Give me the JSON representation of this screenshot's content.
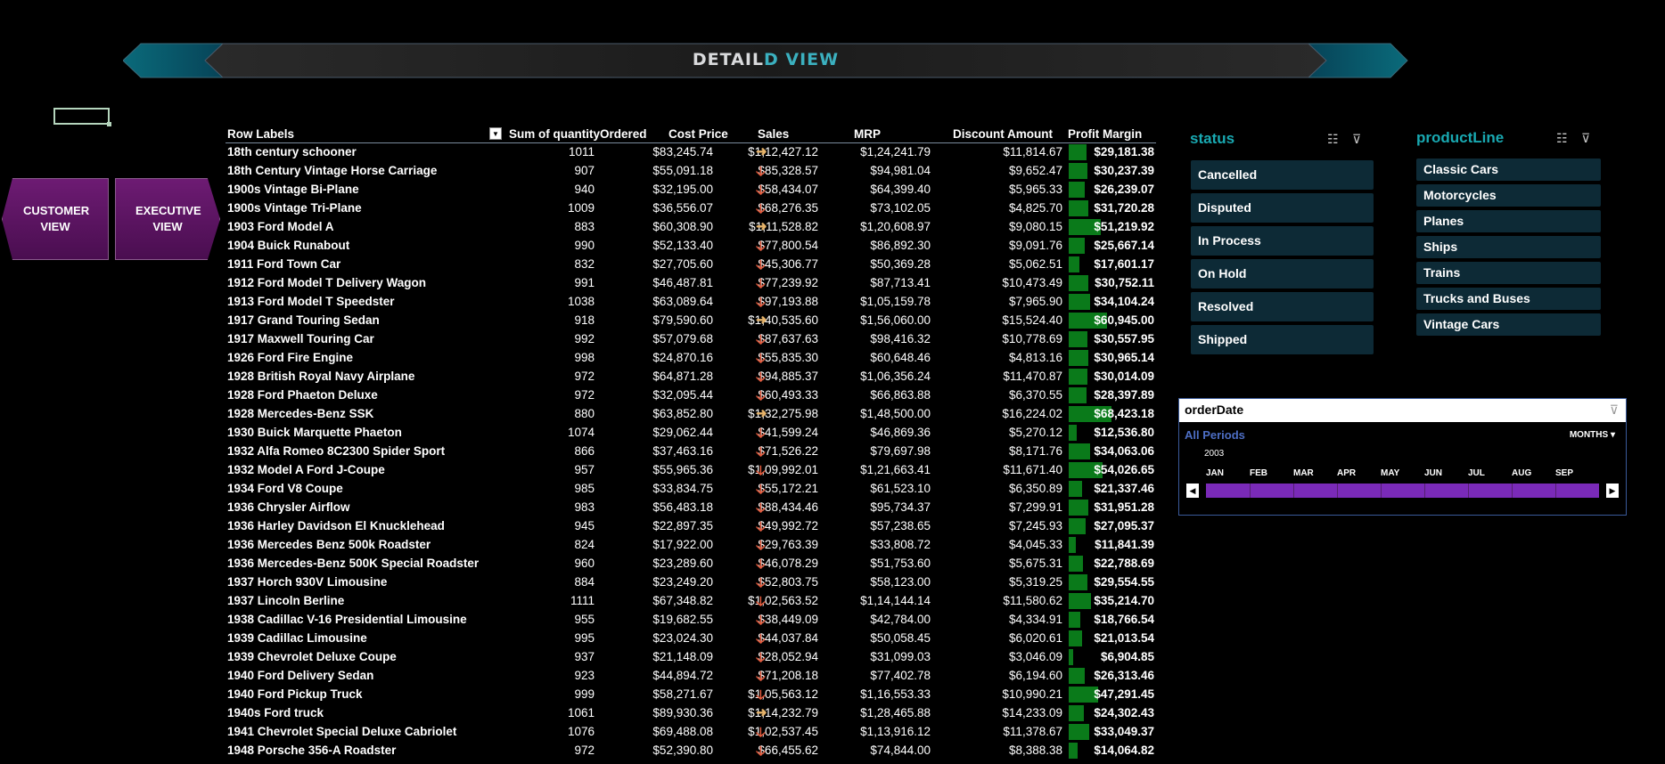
{
  "banner": {
    "title_a": "DETAIL",
    "title_b": "D VIEW"
  },
  "nav": {
    "customer": "CUSTOMER VIEW",
    "executive": "EXECUTIVE VIEW"
  },
  "pivot": {
    "headers": {
      "row_labels": "Row Labels",
      "qty": "Sum of quantityOrdered",
      "cost": "Cost Price",
      "sales": "Sales",
      "mrp": "MRP",
      "discount": "Discount Amount",
      "profit": "Profit Margin"
    },
    "rows": [
      {
        "name": "18th century schooner",
        "qty": "1011",
        "cost": "$83,245.74",
        "icon": "right",
        "sales": "$1,12,427.12",
        "mrp": "$1,24,241.79",
        "disc": "$11,814.67",
        "profit": "$29,181.38",
        "pm": 29181.38
      },
      {
        "name": "18th Century Vintage Horse Carriage",
        "qty": "907",
        "cost": "$55,091.18",
        "icon": "down",
        "sales": "$85,328.57",
        "mrp": "$94,981.04",
        "disc": "$9,652.47",
        "profit": "$30,237.39",
        "pm": 30237.39
      },
      {
        "name": "1900s Vintage Bi-Plane",
        "qty": "940",
        "cost": "$32,195.00",
        "icon": "down",
        "sales": "$58,434.07",
        "mrp": "$64,399.40",
        "disc": "$5,965.33",
        "profit": "$26,239.07",
        "pm": 26239.07
      },
      {
        "name": "1900s Vintage Tri-Plane",
        "qty": "1009",
        "cost": "$36,556.07",
        "icon": "down",
        "sales": "$68,276.35",
        "mrp": "$73,102.05",
        "disc": "$4,825.70",
        "profit": "$31,720.28",
        "pm": 31720.28
      },
      {
        "name": "1903 Ford Model A",
        "qty": "883",
        "cost": "$60,308.90",
        "icon": "right",
        "sales": "$1,11,528.82",
        "mrp": "$1,20,608.97",
        "disc": "$9,080.15",
        "profit": "$51,219.92",
        "pm": 51219.92
      },
      {
        "name": "1904 Buick Runabout",
        "qty": "990",
        "cost": "$52,133.40",
        "icon": "down",
        "sales": "$77,800.54",
        "mrp": "$86,892.30",
        "disc": "$9,091.76",
        "profit": "$25,667.14",
        "pm": 25667.14
      },
      {
        "name": "1911 Ford Town Car",
        "qty": "832",
        "cost": "$27,705.60",
        "icon": "down",
        "sales": "$45,306.77",
        "mrp": "$50,369.28",
        "disc": "$5,062.51",
        "profit": "$17,601.17",
        "pm": 17601.17
      },
      {
        "name": "1912 Ford Model T Delivery Wagon",
        "qty": "991",
        "cost": "$46,487.81",
        "icon": "down",
        "sales": "$77,239.92",
        "mrp": "$87,713.41",
        "disc": "$10,473.49",
        "profit": "$30,752.11",
        "pm": 30752.11
      },
      {
        "name": "1913 Ford Model T Speedster",
        "qty": "1038",
        "cost": "$63,089.64",
        "icon": "down",
        "sales": "$97,193.88",
        "mrp": "$1,05,159.78",
        "disc": "$7,965.90",
        "profit": "$34,104.24",
        "pm": 34104.24
      },
      {
        "name": "1917 Grand Touring Sedan",
        "qty": "918",
        "cost": "$79,590.60",
        "icon": "right",
        "sales": "$1,40,535.60",
        "mrp": "$1,56,060.00",
        "disc": "$15,524.40",
        "profit": "$60,945.00",
        "pm": 60945.0
      },
      {
        "name": "1917 Maxwell Touring Car",
        "qty": "992",
        "cost": "$57,079.68",
        "icon": "down",
        "sales": "$87,637.63",
        "mrp": "$98,416.32",
        "disc": "$10,778.69",
        "profit": "$30,557.95",
        "pm": 30557.95
      },
      {
        "name": "1926 Ford Fire Engine",
        "qty": "998",
        "cost": "$24,870.16",
        "icon": "down",
        "sales": "$55,835.30",
        "mrp": "$60,648.46",
        "disc": "$4,813.16",
        "profit": "$30,965.14",
        "pm": 30965.14
      },
      {
        "name": "1928 British Royal Navy Airplane",
        "qty": "972",
        "cost": "$64,871.28",
        "icon": "down",
        "sales": "$94,885.37",
        "mrp": "$1,06,356.24",
        "disc": "$11,470.87",
        "profit": "$30,014.09",
        "pm": 30014.09
      },
      {
        "name": "1928 Ford Phaeton Deluxe",
        "qty": "972",
        "cost": "$32,095.44",
        "icon": "down",
        "sales": "$60,493.33",
        "mrp": "$66,863.88",
        "disc": "$6,370.55",
        "profit": "$28,397.89",
        "pm": 28397.89
      },
      {
        "name": "1928 Mercedes-Benz SSK",
        "qty": "880",
        "cost": "$63,852.80",
        "icon": "right",
        "sales": "$1,32,275.98",
        "mrp": "$1,48,500.00",
        "disc": "$16,224.02",
        "profit": "$68,423.18",
        "pm": 68423.18
      },
      {
        "name": "1930 Buick Marquette Phaeton",
        "qty": "1074",
        "cost": "$29,062.44",
        "icon": "down",
        "sales": "$41,599.24",
        "mrp": "$46,869.36",
        "disc": "$5,270.12",
        "profit": "$12,536.80",
        "pm": 12536.8
      },
      {
        "name": "1932 Alfa Romeo 8C2300 Spider Sport",
        "qty": "866",
        "cost": "$37,463.16",
        "icon": "down",
        "sales": "$71,526.22",
        "mrp": "$79,697.98",
        "disc": "$8,171.76",
        "profit": "$34,063.06",
        "pm": 34063.06
      },
      {
        "name": "1932 Model A Ford J-Coupe",
        "qty": "957",
        "cost": "$55,965.36",
        "icon": "down",
        "sales": "$1,09,992.01",
        "mrp": "$1,21,663.41",
        "disc": "$11,671.40",
        "profit": "$54,026.65",
        "pm": 54026.65
      },
      {
        "name": "1934 Ford V8 Coupe",
        "qty": "985",
        "cost": "$33,834.75",
        "icon": "down",
        "sales": "$55,172.21",
        "mrp": "$61,523.10",
        "disc": "$6,350.89",
        "profit": "$21,337.46",
        "pm": 21337.46
      },
      {
        "name": "1936 Chrysler Airflow",
        "qty": "983",
        "cost": "$56,483.18",
        "icon": "down",
        "sales": "$88,434.46",
        "mrp": "$95,734.37",
        "disc": "$7,299.91",
        "profit": "$31,951.28",
        "pm": 31951.28
      },
      {
        "name": "1936 Harley Davidson El Knucklehead",
        "qty": "945",
        "cost": "$22,897.35",
        "icon": "down",
        "sales": "$49,992.72",
        "mrp": "$57,238.65",
        "disc": "$7,245.93",
        "profit": "$27,095.37",
        "pm": 27095.37
      },
      {
        "name": "1936 Mercedes Benz 500k Roadster",
        "qty": "824",
        "cost": "$17,922.00",
        "icon": "down",
        "sales": "$29,763.39",
        "mrp": "$33,808.72",
        "disc": "$4,045.33",
        "profit": "$11,841.39",
        "pm": 11841.39
      },
      {
        "name": "1936 Mercedes-Benz 500K Special Roadster",
        "qty": "960",
        "cost": "$23,289.60",
        "icon": "down",
        "sales": "$46,078.29",
        "mrp": "$51,753.60",
        "disc": "$5,675.31",
        "profit": "$22,788.69",
        "pm": 22788.69
      },
      {
        "name": "1937 Horch 930V Limousine",
        "qty": "884",
        "cost": "$23,249.20",
        "icon": "down",
        "sales": "$52,803.75",
        "mrp": "$58,123.00",
        "disc": "$5,319.25",
        "profit": "$29,554.55",
        "pm": 29554.55
      },
      {
        "name": "1937 Lincoln Berline",
        "qty": "1111",
        "cost": "$67,348.82",
        "icon": "down",
        "sales": "$1,02,563.52",
        "mrp": "$1,14,144.14",
        "disc": "$11,580.62",
        "profit": "$35,214.70",
        "pm": 35214.7
      },
      {
        "name": "1938 Cadillac V-16 Presidential Limousine",
        "qty": "955",
        "cost": "$19,682.55",
        "icon": "down",
        "sales": "$38,449.09",
        "mrp": "$42,784.00",
        "disc": "$4,334.91",
        "profit": "$18,766.54",
        "pm": 18766.54
      },
      {
        "name": "1939 Cadillac Limousine",
        "qty": "995",
        "cost": "$23,024.30",
        "icon": "down",
        "sales": "$44,037.84",
        "mrp": "$50,058.45",
        "disc": "$6,020.61",
        "profit": "$21,013.54",
        "pm": 21013.54
      },
      {
        "name": "1939 Chevrolet Deluxe Coupe",
        "qty": "937",
        "cost": "$21,148.09",
        "icon": "down",
        "sales": "$28,052.94",
        "mrp": "$31,099.03",
        "disc": "$3,046.09",
        "profit": "$6,904.85",
        "pm": 6904.85
      },
      {
        "name": "1940 Ford Delivery Sedan",
        "qty": "923",
        "cost": "$44,894.72",
        "icon": "down",
        "sales": "$71,208.18",
        "mrp": "$77,402.78",
        "disc": "$6,194.60",
        "profit": "$26,313.46",
        "pm": 26313.46
      },
      {
        "name": "1940 Ford Pickup Truck",
        "qty": "999",
        "cost": "$58,271.67",
        "icon": "down",
        "sales": "$1,05,563.12",
        "mrp": "$1,16,553.33",
        "disc": "$10,990.21",
        "profit": "$47,291.45",
        "pm": 47291.45
      },
      {
        "name": "1940s Ford truck",
        "qty": "1061",
        "cost": "$89,930.36",
        "icon": "right",
        "sales": "$1,14,232.79",
        "mrp": "$1,28,465.88",
        "disc": "$14,233.09",
        "profit": "$24,302.43",
        "pm": 24302.43
      },
      {
        "name": "1941 Chevrolet Special Deluxe Cabriolet",
        "qty": "1076",
        "cost": "$69,488.08",
        "icon": "down",
        "sales": "$1,02,537.45",
        "mrp": "$1,13,916.12",
        "disc": "$11,378.67",
        "profit": "$33,049.37",
        "pm": 33049.37
      },
      {
        "name": "1948 Porsche 356-A Roadster",
        "qty": "972",
        "cost": "$52,390.80",
        "icon": "down",
        "sales": "$66,455.62",
        "mrp": "$74,844.00",
        "disc": "$8,388.38",
        "profit": "$14,064.82",
        "pm": 14064.82
      }
    ],
    "icon_colors": {
      "down": "#e2593b",
      "right": "#e6b36a"
    },
    "bar_color": "#0a7a1a"
  },
  "slicers": {
    "status": {
      "title": "status",
      "items": [
        "Cancelled",
        "Disputed",
        "In Process",
        "On Hold",
        "Resolved",
        "Shipped"
      ]
    },
    "productLine": {
      "title": "productLine",
      "items": [
        "Classic Cars",
        "Motorcycles",
        "Planes",
        "Ships",
        "Trains",
        "Trucks and Buses",
        "Vintage Cars"
      ]
    }
  },
  "timeline": {
    "title": "orderDate",
    "all_periods": "All Periods",
    "level": "MONTHS",
    "year": "2003",
    "months": [
      "JAN",
      "FEB",
      "MAR",
      "APR",
      "MAY",
      "JUN",
      "JUL",
      "AUG",
      "SEP"
    ]
  }
}
